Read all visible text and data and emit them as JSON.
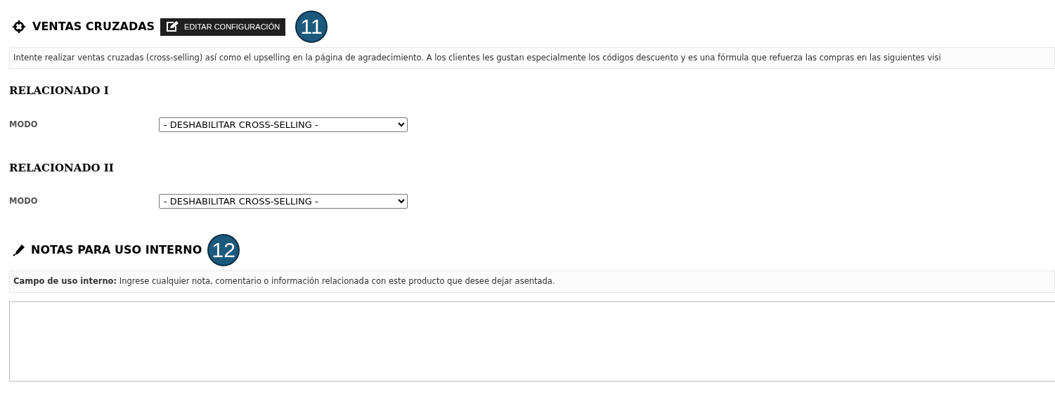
{
  "cross_selling": {
    "title": "VENTAS CRUZADAS",
    "edit_button": "EDITAR CONFIGURACIÓN",
    "step_badge": "11",
    "info": "Intente realizar ventas cruzadas (cross-selling) así como el upselling en la página de agradecimiento. A los clientes les gustan especialmente los códigos descuento y es una fórmula que refuerza las compras en las siguientes visi",
    "groups": [
      {
        "title": "RELACIONADO I",
        "label": "MODO",
        "value": "- DESHABILITAR CROSS-SELLING -"
      },
      {
        "title": "RELACIONADO II",
        "label": "MODO",
        "value": "- DESHABILITAR CROSS-SELLING -"
      }
    ]
  },
  "notes": {
    "title": "NOTAS PARA USO INTERNO",
    "step_badge": "12",
    "info": "**Campo de uso interno:** Ingrese cualquier nota, comentario o información relacionada con este producto que desee dejar asentada."
  }
}
